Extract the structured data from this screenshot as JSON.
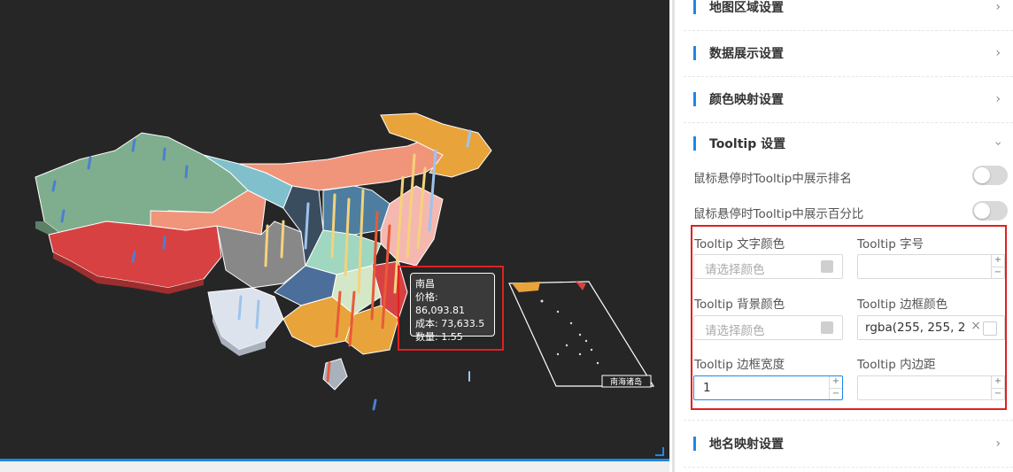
{
  "tooltip": {
    "name": "南昌",
    "price_line": "价格: 86,093.81",
    "cost_line": "成本: 73,633.5",
    "qty_line": "数量: 1.55"
  },
  "inset_label": "南海诸岛",
  "settings": {
    "sections": [
      {
        "title": "地图区域设置",
        "expanded": false
      },
      {
        "title": "数据展示设置",
        "expanded": false
      },
      {
        "title": "颜色映射设置",
        "expanded": false
      },
      {
        "title": "Tooltip 设置",
        "expanded": true
      },
      {
        "title": "地名映射设置",
        "expanded": false
      }
    ],
    "toggles": [
      {
        "label": "鼠标悬停时Tooltip中展示排名",
        "on": false
      },
      {
        "label": "鼠标悬停时Tooltip中展示百分比",
        "on": false
      }
    ],
    "fields": {
      "text_color_label": "Tooltip 文字颜色",
      "text_color_placeholder": "请选择颜色",
      "font_size_label": "Tooltip 字号",
      "font_size_value": "",
      "bg_color_label": "Tooltip 背景颜色",
      "bg_color_placeholder": "请选择颜色",
      "border_color_label": "Tooltip 边框颜色",
      "border_color_value": "rgba(255, 255, 2",
      "border_width_label": "Tooltip 边框宽度",
      "border_width_value": "1",
      "padding_label": "Tooltip 内边距",
      "padding_value": ""
    }
  },
  "colors": {
    "accent": "#1e88e5",
    "highlight_red": "#e02020",
    "map_bg": "#262626"
  }
}
